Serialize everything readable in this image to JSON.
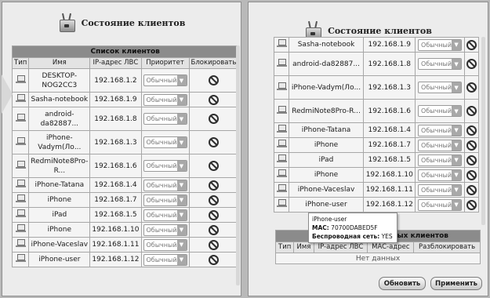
{
  "left": {
    "title": "Состояние клиентов",
    "table_caption": "Список клиентов",
    "columns": [
      "Тип",
      "Имя",
      "IP-адрес ЛВС",
      "Приоритет",
      "Блокировать"
    ],
    "rows": [
      {
        "name": "DESKTOP-NOG2CC3",
        "ip": "192.168.1.2",
        "priority": "Обычный"
      },
      {
        "name": "Sasha-notebook",
        "ip": "192.168.1.9",
        "priority": "Обычный"
      },
      {
        "name": "android-da82887...",
        "ip": "192.168.1.8",
        "priority": "Обычный"
      },
      {
        "name": "iPhone-Vadym(Ло...",
        "ip": "192.168.1.3",
        "priority": "Обычный"
      },
      {
        "name": "RedmiNote8Pro-R...",
        "ip": "192.168.1.6",
        "priority": "Обычный"
      },
      {
        "name": "iPhone-Tatana",
        "ip": "192.168.1.4",
        "priority": "Обычный"
      },
      {
        "name": "iPhone",
        "ip": "192.168.1.7",
        "priority": "Обычный"
      },
      {
        "name": "iPad",
        "ip": "192.168.1.5",
        "priority": "Обычный"
      },
      {
        "name": "iPhone",
        "ip": "192.168.1.10",
        "priority": "Обычный"
      },
      {
        "name": "iPhone-Vaceslav",
        "ip": "192.168.1.11",
        "priority": "Обычный"
      },
      {
        "name": "iPhone-user",
        "ip": "192.168.1.12",
        "priority": "Обычный"
      }
    ]
  },
  "right": {
    "title": "Состояние клиентов",
    "rows": [
      {
        "name": "Sasha-notebook",
        "ip": "192.168.1.9",
        "priority": "Обычный"
      },
      {
        "name": "android-da82887...",
        "ip": "192.168.1.8",
        "priority": "Обычный"
      },
      {
        "name": "iPhone-Vadym(Ло...",
        "ip": "192.168.1.3",
        "priority": "Обычный"
      },
      {
        "name": "RedmiNote8Pro-R...",
        "ip": "192.168.1.6",
        "priority": "Обычный"
      },
      {
        "name": "iPhone-Tatana",
        "ip": "192.168.1.4",
        "priority": "Обычный"
      },
      {
        "name": "iPhone",
        "ip": "192.168.1.7",
        "priority": "Обычный"
      },
      {
        "name": "iPad",
        "ip": "192.168.1.5",
        "priority": "Обычный"
      },
      {
        "name": "iPhone",
        "ip": "192.168.1.10",
        "priority": "Обычный"
      },
      {
        "name": "iPhone-Vaceslav",
        "ip": "192.168.1.11",
        "priority": "Обычный"
      },
      {
        "name": "iPhone-user",
        "ip": "192.168.1.12",
        "priority": "Обычный"
      }
    ],
    "blocked_caption": "ных клиентов",
    "blocked_columns": [
      "Тип",
      "Имя",
      "IP-адрес ЛВС",
      "MAC-адрес",
      "Разблокировать"
    ],
    "no_data": "Нет данных",
    "refresh_button": "Обновить",
    "apply_button": "Применить",
    "tooltip": {
      "device": "iPhone-user",
      "mac_label": "MAC:",
      "mac_value": "70700DABED5F",
      "wireless_label": "Беспроводная сеть:",
      "wireless_value": "YES"
    }
  },
  "icons": {
    "router": "router-icon",
    "device": "device-icon",
    "block": "block-icon",
    "dropdown": "chevron-down-icon"
  }
}
